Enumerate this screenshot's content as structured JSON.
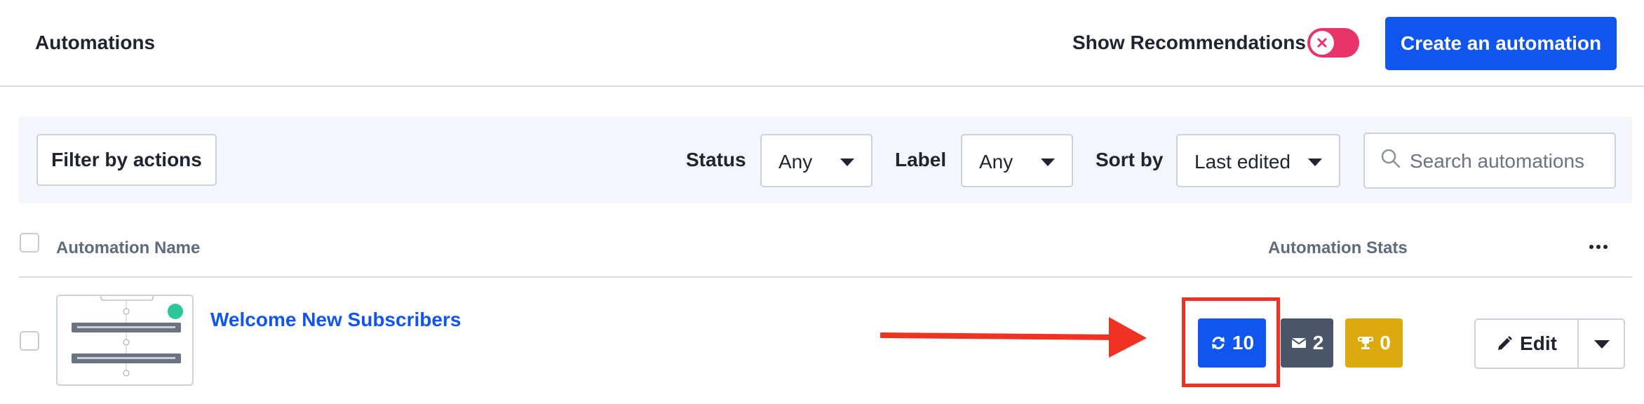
{
  "header": {
    "title": "Automations",
    "recommendations_label": "Show Recommendations",
    "recommendations_enabled": false,
    "create_button": "Create an automation"
  },
  "filters": {
    "filter_actions_button": "Filter by actions",
    "status": {
      "label": "Status",
      "value": "Any"
    },
    "label": {
      "label": "Label",
      "value": "Any"
    },
    "sort": {
      "label": "Sort by",
      "value": "Last edited"
    },
    "search": {
      "placeholder": "Search automations",
      "value": ""
    }
  },
  "table": {
    "columns": {
      "name": "Automation Name",
      "stats": "Automation Stats"
    },
    "rows": [
      {
        "name": "Welcome New Subscribers",
        "stats": {
          "runs": "10",
          "emails": "2",
          "goals": "0"
        },
        "edit_label": "Edit"
      }
    ]
  },
  "colors": {
    "primary": "#1055f0",
    "toggle_off": "#e8336b",
    "emails_badge": "#4b5569",
    "goals_badge": "#dcaa0c",
    "annotation": "#ee3322",
    "thumbnail_status": "#2bc79a"
  },
  "icons": {
    "toggle": "x-icon",
    "search": "magnifier-icon",
    "runs": "refresh-icon",
    "emails": "envelope-icon",
    "goals": "trophy-icon",
    "edit": "pencil-icon",
    "more": "ellipsis-icon"
  }
}
